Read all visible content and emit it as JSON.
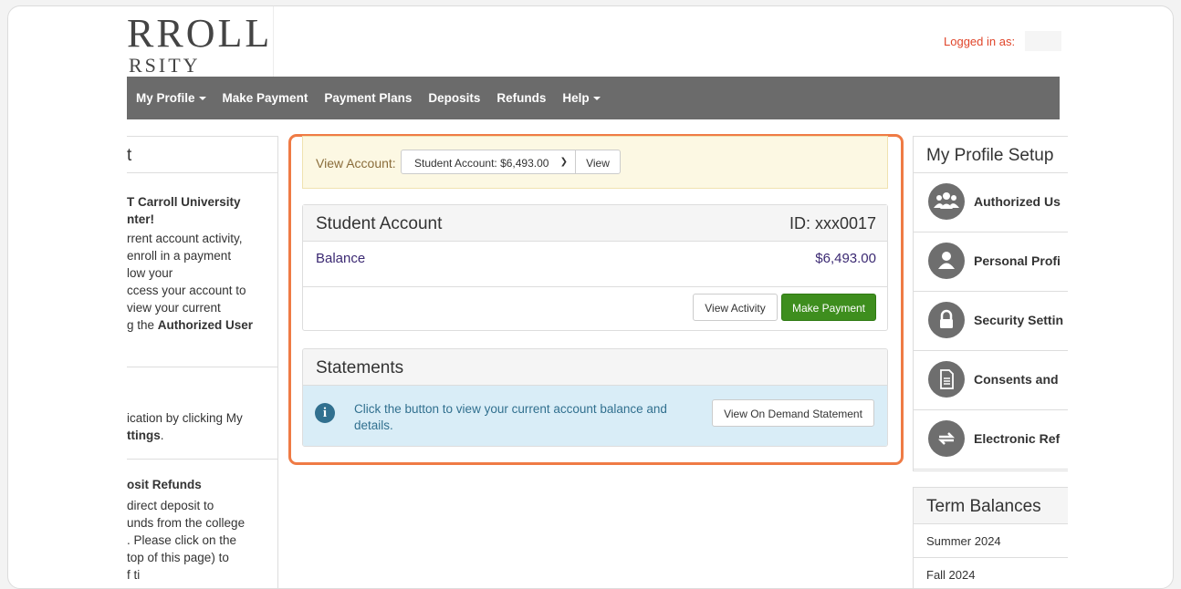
{
  "header": {
    "logo_line1": "RROLL",
    "logo_line2": "RSITY",
    "logged_in_label": "Logged in as:"
  },
  "nav": {
    "items": [
      {
        "label": "My Profile",
        "dropdown": true
      },
      {
        "label": "Make Payment",
        "dropdown": false
      },
      {
        "label": "Payment Plans",
        "dropdown": false
      },
      {
        "label": "Deposits",
        "dropdown": false
      },
      {
        "label": "Refunds",
        "dropdown": false
      },
      {
        "label": "Help",
        "dropdown": true
      }
    ]
  },
  "left_panel": {
    "heading": "t",
    "welcome_line1": "T Carroll University",
    "welcome_line2": "nter!",
    "intro_lines": [
      "rrent account activity,",
      "enroll in a payment",
      "low your",
      "ccess your account to",
      "view your current"
    ],
    "auth_line_prefix": "g the ",
    "auth_line_bold": "Authorized User",
    "verify_line1": "ication by clicking My",
    "verify_line2_bold": "ttings",
    "verify_line2_tail": ".",
    "refund_heading": "osit Refunds",
    "refund_lines": [
      "direct deposit to",
      "unds from the college",
      ".  Please click on the",
      "top of this page) to",
      "f      ti"
    ]
  },
  "view_account": {
    "label": "View Account:",
    "selected": "Student Account: $6,493.00",
    "view_button": "View"
  },
  "student_account": {
    "title": "Student Account",
    "id": "ID: xxx0017",
    "balance_label": "Balance",
    "balance_value": "$6,493.00",
    "view_activity": "View Activity",
    "make_payment": "Make Payment"
  },
  "statements": {
    "title": "Statements",
    "info_icon": "i",
    "message": "Click the button to view your current account balance and details.",
    "button": "View On Demand Statement"
  },
  "profile_setup": {
    "title": "My Profile Setup",
    "items": [
      {
        "label": "Authorized Us",
        "icon": "users-icon"
      },
      {
        "label": "Personal Profi",
        "icon": "person-icon"
      },
      {
        "label": "Security Settin",
        "icon": "lock-icon"
      },
      {
        "label": "Consents and",
        "icon": "document-icon"
      },
      {
        "label": "Electronic Ref",
        "icon": "refresh-icon"
      }
    ]
  },
  "term_balances": {
    "title": "Term Balances",
    "terms": [
      "Summer 2024",
      "Fall 2024"
    ]
  },
  "colors": {
    "nav_bg": "#6b6b6b",
    "highlight_outline": "#ef7b45",
    "success_button": "#3e8e1e",
    "logged_in_text": "#e0452a"
  }
}
